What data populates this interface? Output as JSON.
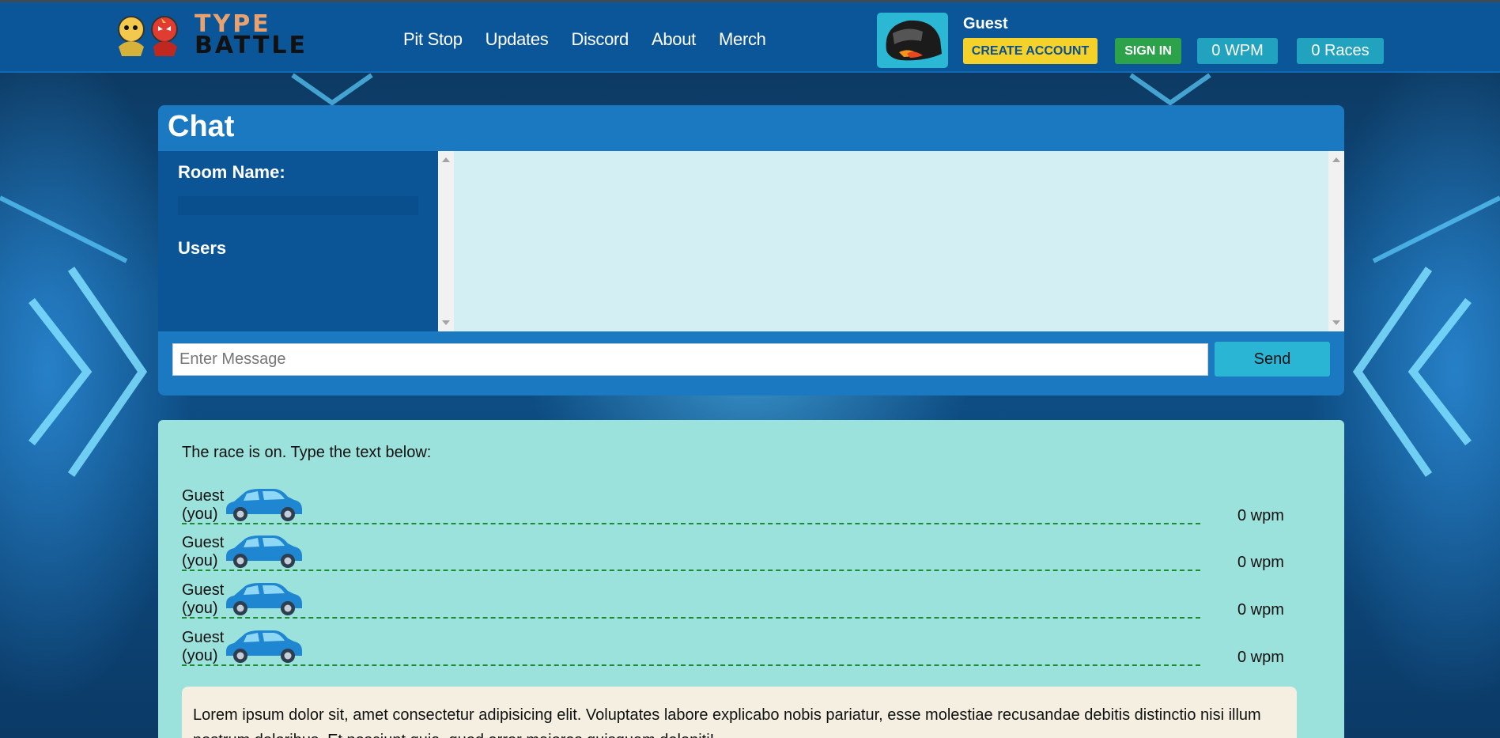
{
  "header": {
    "logo": {
      "line1": "TYPE",
      "line2": "BATTLE"
    },
    "nav": [
      "Pit Stop",
      "Updates",
      "Discord",
      "About",
      "Merch"
    ],
    "user_name": "Guest",
    "create_account": "CREATE ACCOUNT",
    "sign_in": "SIGN IN",
    "wpm": "0 WPM",
    "races": "0 Races"
  },
  "chat": {
    "title": "Chat",
    "room_name_label": "Room Name:",
    "users_label": "Users",
    "message_placeholder": "Enter Message",
    "send_label": "Send"
  },
  "race": {
    "intro": "The race is on. Type the text below:",
    "racers": [
      {
        "name": "Guest",
        "tag": "(you)",
        "wpm": "0 wpm"
      },
      {
        "name": "Guest",
        "tag": "(you)",
        "wpm": "0 wpm"
      },
      {
        "name": "Guest",
        "tag": "(you)",
        "wpm": "0 wpm"
      },
      {
        "name": "Guest",
        "tag": "(you)",
        "wpm": "0 wpm"
      }
    ],
    "text": "Lorem ipsum dolor sit, amet consectetur adipisicing elit. Voluptates labore explicabo nobis pariatur, esse molestiae recusandae debitis distinctio nisi illum nostrum doloribus. Et nesciunt quia, quod error maiores quisquam deleniti!"
  },
  "colors": {
    "header_bg": "#0a5699",
    "chat_bg": "#1a79c1",
    "race_bg": "#9ce2dc",
    "create_btn": "#f4d22a",
    "signin_btn": "#2ca24a",
    "stat_bg": "#21a3c0"
  }
}
